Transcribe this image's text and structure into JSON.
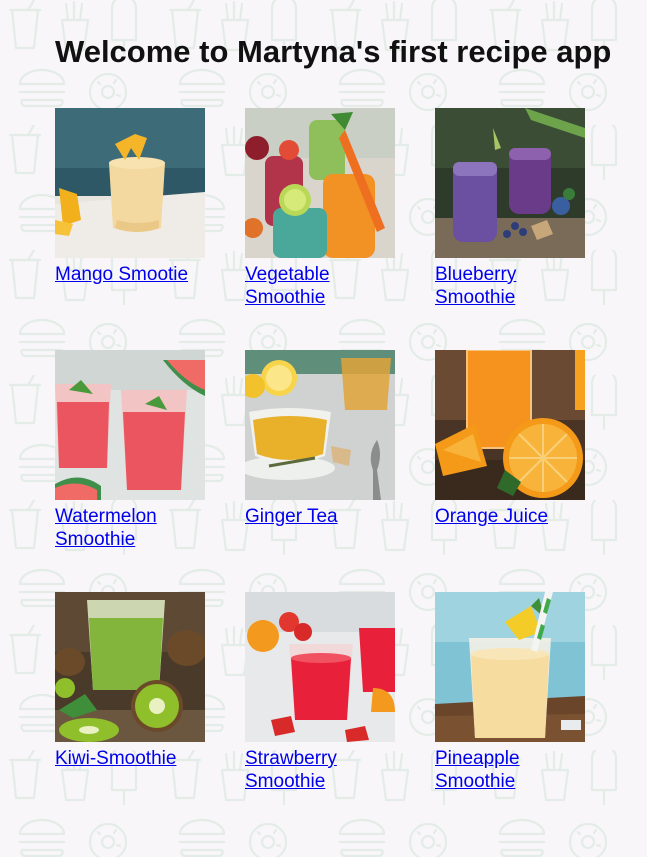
{
  "page": {
    "title": "Welcome to Martyna's first recipe app"
  },
  "recipes": [
    {
      "label": "Mango Smootie",
      "image": "mango-smoothie-photo"
    },
    {
      "label": "Vegetable Smoothie",
      "image": "vegetable-smoothie-photo"
    },
    {
      "label": "Blueberry Smoothie",
      "image": "blueberry-smoothie-photo"
    },
    {
      "label": "Watermelon Smoothie",
      "image": "watermelon-smoothie-photo"
    },
    {
      "label": "Ginger Tea",
      "image": "ginger-tea-photo"
    },
    {
      "label": "Orange Juice",
      "image": "orange-juice-photo"
    },
    {
      "label": "Kiwi-Smoothie",
      "image": "kiwi-smoothie-photo"
    },
    {
      "label": "Strawberry Smoothie",
      "image": "strawberry-smoothie-photo"
    },
    {
      "label": "Pineapple Smoothie",
      "image": "pineapple-smoothie-photo"
    }
  ],
  "colors": {
    "background": "#f8f6f8",
    "pattern": "#e3ece6",
    "link": "#0000ee",
    "heading": "#111111"
  }
}
